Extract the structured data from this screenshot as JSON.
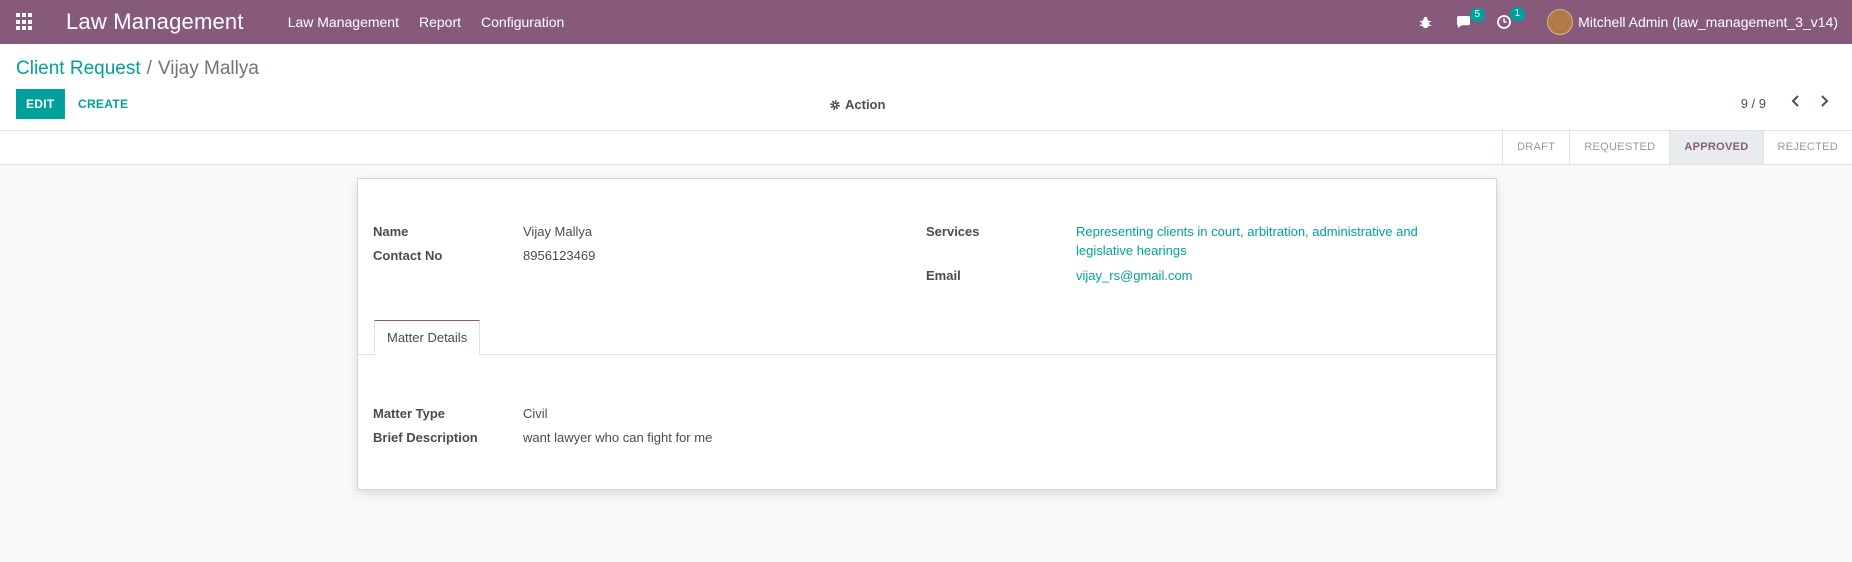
{
  "navbar": {
    "brand": "Law Management",
    "menu": [
      "Law Management",
      "Report",
      "Configuration"
    ],
    "messages_count": "5",
    "activities_count": "1",
    "user": "Mitchell Admin (law_management_3_v14)"
  },
  "breadcrumb": {
    "parent": "Client Request",
    "separator": "/",
    "current": "Vijay Mallya"
  },
  "buttons": {
    "edit": "EDIT",
    "create": "CREATE",
    "action": "Action"
  },
  "pager": {
    "value": "9 / 9"
  },
  "statusbar": {
    "stages": [
      "DRAFT",
      "REQUESTED",
      "APPROVED",
      "REJECTED"
    ],
    "active": "APPROVED"
  },
  "form": {
    "name_label": "Name",
    "name_value": "Vijay Mallya",
    "contact_label": "Contact No",
    "contact_value": "8956123469",
    "services_label": "Services",
    "services_value_line1": "Representing clients in court, arbitration, administrative and",
    "services_value_line2": "legislative hearings",
    "email_label": "Email",
    "email_value": "vijay_rs@gmail.com",
    "tab_label": "Matter Details",
    "matter_type_label": "Matter Type",
    "matter_type_value": "Civil",
    "brief_label": "Brief Description",
    "brief_value": "want lawyer who can fight for me"
  },
  "colors": {
    "navbar": "#875a7b",
    "accent": "#00a09d"
  }
}
